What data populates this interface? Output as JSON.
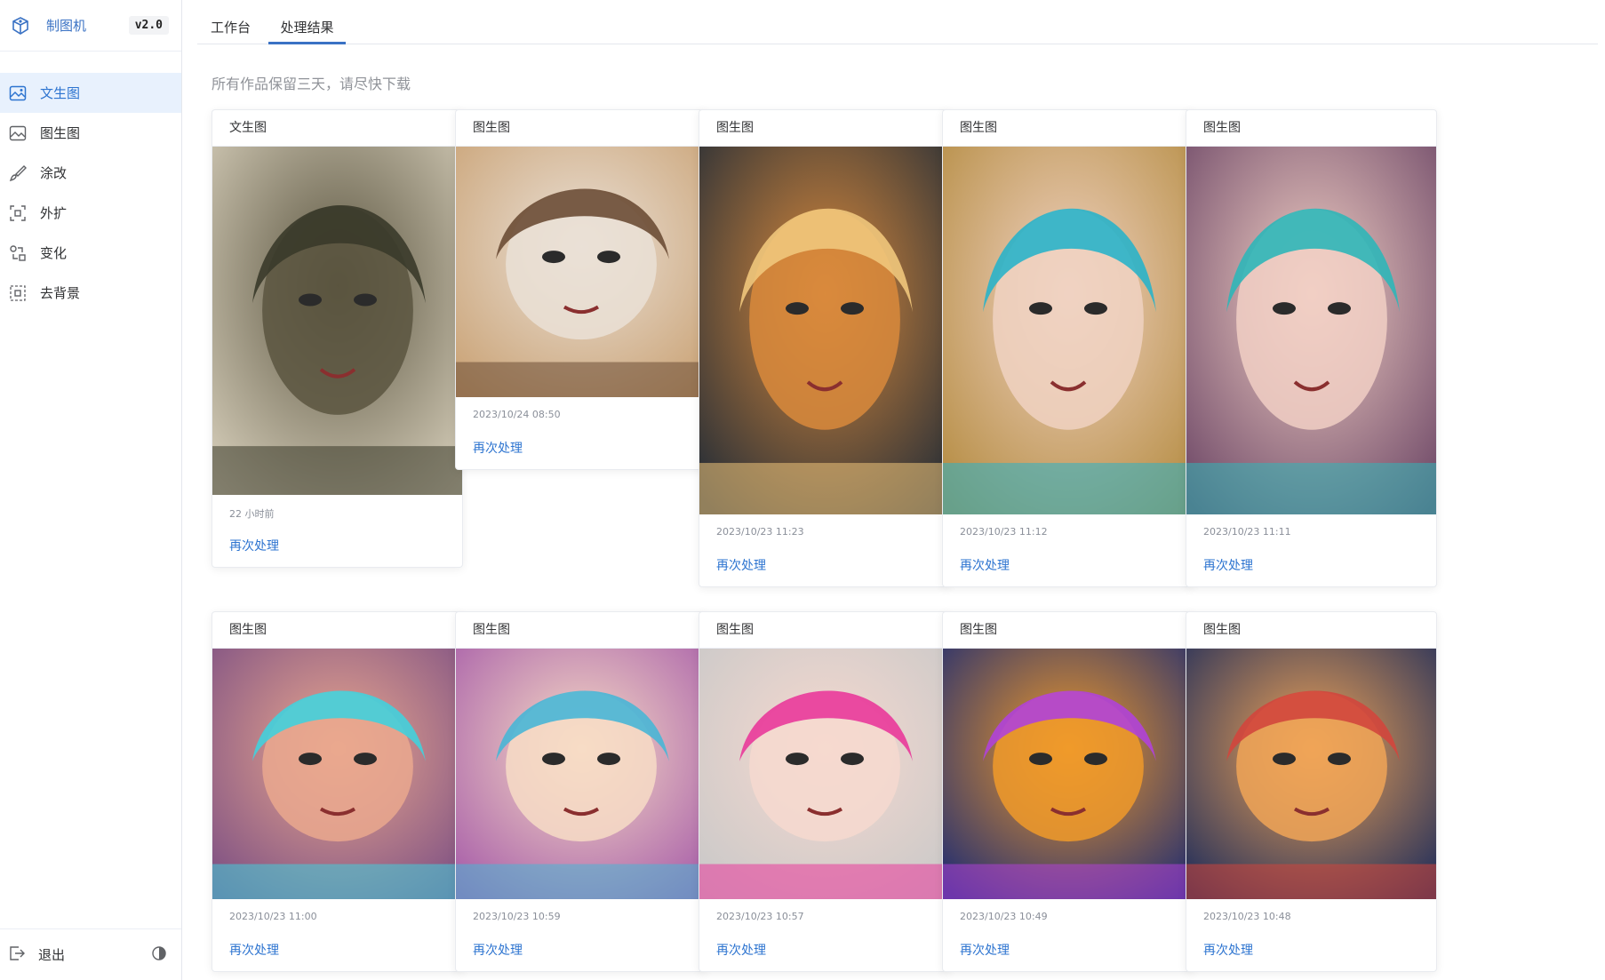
{
  "app": {
    "name": "制图机",
    "version": "v2.0"
  },
  "sidebar": {
    "items": [
      {
        "label": "文生图",
        "icon": "text-to-image-icon",
        "active": true
      },
      {
        "label": "图生图",
        "icon": "image-to-image-icon",
        "active": false
      },
      {
        "label": "涂改",
        "icon": "brush-icon",
        "active": false
      },
      {
        "label": "外扩",
        "icon": "outpaint-icon",
        "active": false
      },
      {
        "label": "变化",
        "icon": "variation-icon",
        "active": false
      },
      {
        "label": "去背景",
        "icon": "remove-background-icon",
        "active": false
      }
    ],
    "logout_label": "退出"
  },
  "tabs": [
    {
      "label": "工作台",
      "active": false
    },
    {
      "label": "处理结果",
      "active": true
    }
  ],
  "notice": "所有作品保留三天，请尽快下载",
  "cards": [
    {
      "type": "文生图",
      "time": "22 小时前",
      "action": "再次处理",
      "palette": [
        "#d8d0bc",
        "#5b5540",
        "#3a3a2a"
      ]
    },
    {
      "type": "图生图",
      "time": "2023/10/24 08:50",
      "action": "再次处理",
      "palette": [
        "#c9a173",
        "#eae0d6",
        "#6b4d35"
      ]
    },
    {
      "type": "图生图",
      "time": "2023/10/23 11:23",
      "action": "再次处理",
      "palette": [
        "#1f2a36",
        "#d98a3c",
        "#f0c77c"
      ]
    },
    {
      "type": "图生图",
      "time": "2023/10/23 11:12",
      "action": "再次处理",
      "palette": [
        "#b38a3e",
        "#f0d2c2",
        "#2ab3c9"
      ]
    },
    {
      "type": "图生图",
      "time": "2023/10/23 11:11",
      "action": "再次处理",
      "palette": [
        "#6b4565",
        "#f1cfc4",
        "#2fb6b8"
      ]
    },
    {
      "type": "图生图",
      "time": "2023/10/23 11:00",
      "action": "再次处理",
      "palette": [
        "#7a4d83",
        "#eaa88e",
        "#42d0dc"
      ]
    },
    {
      "type": "图生图",
      "time": "2023/10/23 10:59",
      "action": "再次处理",
      "palette": [
        "#a55aa8",
        "#f7dcc5",
        "#49b6d6"
      ]
    },
    {
      "type": "图生图",
      "time": "2023/10/23 10:57",
      "action": "再次处理",
      "palette": [
        "#c8c8c8",
        "#f6d9cf",
        "#e9399a"
      ]
    },
    {
      "type": "图生图",
      "time": "2023/10/23 10:49",
      "action": "再次处理",
      "palette": [
        "#1b2a73",
        "#f09a2a",
        "#b042d8"
      ]
    },
    {
      "type": "图生图",
      "time": "2023/10/23 10:48",
      "action": "再次处理",
      "palette": [
        "#1c2b5a",
        "#f0a457",
        "#d2463d"
      ]
    }
  ],
  "colors": {
    "accent": "#2d74d0",
    "active_bg": "#e8f1fd",
    "muted_text": "#909399"
  }
}
